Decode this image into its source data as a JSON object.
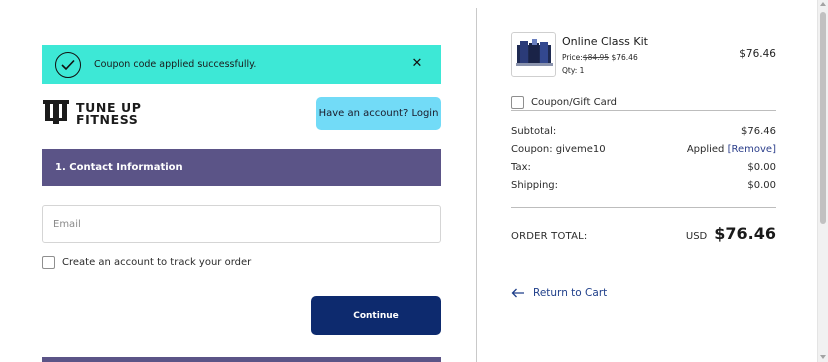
{
  "banner": {
    "message": "Coupon code applied successfully.",
    "close_symbol": "✕",
    "bg_color": "#3de8d6"
  },
  "logo": {
    "line1": "TUNE UP",
    "line2": "FITNESS"
  },
  "header": {
    "login_label": "Have an account? Login"
  },
  "contact": {
    "section_title": "1. Contact Information",
    "email_placeholder": "Email",
    "create_account_label": "Create an account to track your order",
    "continue_label": "Continue"
  },
  "cart": {
    "item": {
      "name": "Online Class Kit",
      "price_label": "Price:",
      "original_price": "$84.95",
      "sale_price": "$76.46",
      "qty_label": "Qty: 1",
      "line_total": "$76.46"
    },
    "coupon_gift_label": "Coupon/Gift Card",
    "summary": {
      "subtotal_label": "Subtotal:",
      "subtotal_value": "$76.46",
      "coupon_label": "Coupon: giveme10",
      "coupon_status": "Applied",
      "coupon_remove": "Remove",
      "tax_label": "Tax:",
      "tax_value": "$0.00",
      "shipping_label": "Shipping:",
      "shipping_value": "$0.00"
    },
    "order_total": {
      "label": "ORDER TOTAL:",
      "currency": "USD",
      "amount": "$76.46"
    },
    "return_label": "Return to Cart"
  },
  "colors": {
    "section_bar": "#5b5487",
    "login_button": "#72dbf7",
    "continue_button": "#0d2a6e",
    "link": "#1f3f8a"
  }
}
